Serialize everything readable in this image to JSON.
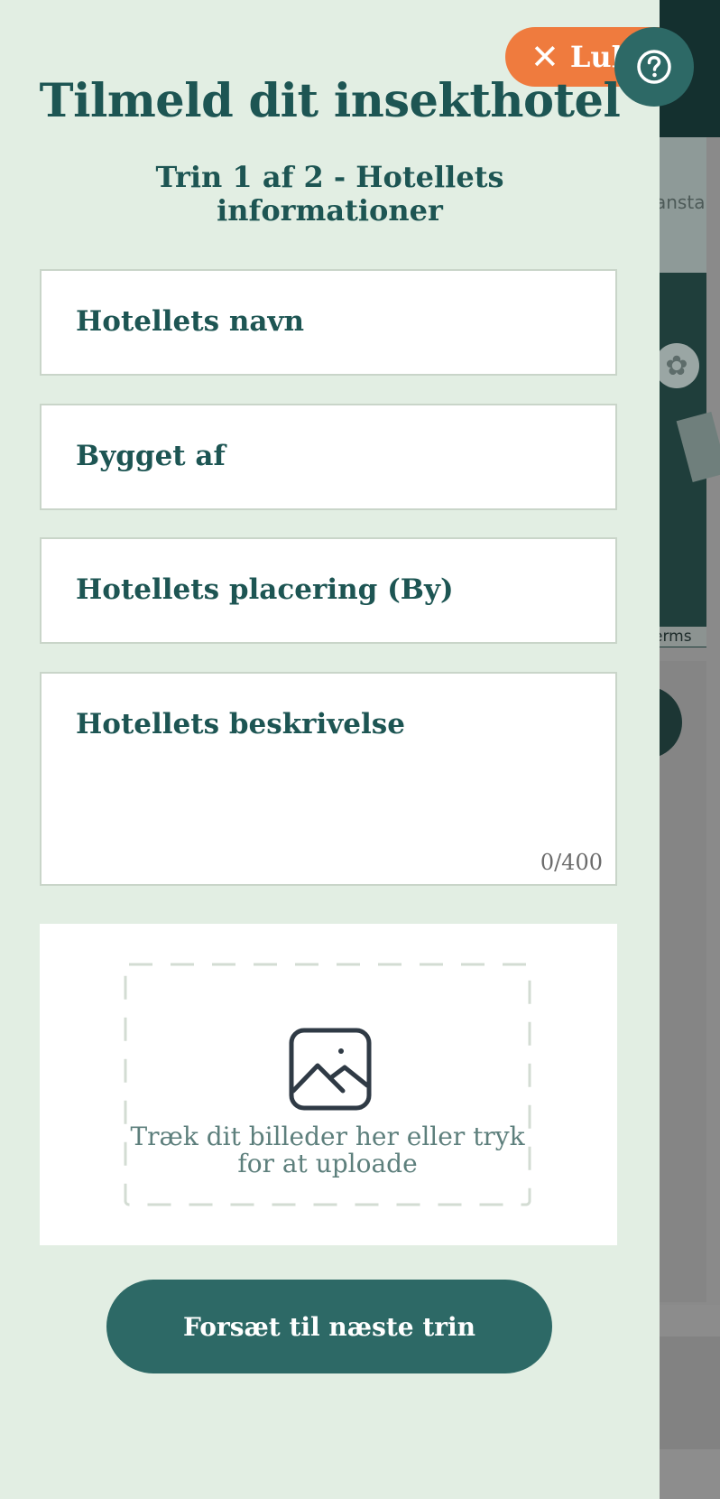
{
  "background": {
    "map_label": "ansta",
    "terms_label": "erms"
  },
  "help": {
    "icon": "question-circle-icon"
  },
  "panel": {
    "close_label": "Luk",
    "close_icon": "close-x-icon",
    "title": "Tilmeld dit insekthotel",
    "subtitle": "Trin 1 af 2 - Hotellets informationer",
    "fields": {
      "name_label": "Hotellets navn",
      "built_by_label": "Bygget af",
      "location_label": "Hotellets placering (By)",
      "description_label": "Hotellets beskrivelse",
      "description_counter": "0/400"
    },
    "upload": {
      "icon": "image-icon",
      "text": "Træk dit billeder her eller tryk for at uploade"
    },
    "continue_label": "Forsæt til næste trin"
  },
  "colors": {
    "panel_bg": "#e2eee3",
    "primary": "#2d6966",
    "accent_orange": "#ef7b3e",
    "heading": "#1d5553"
  }
}
